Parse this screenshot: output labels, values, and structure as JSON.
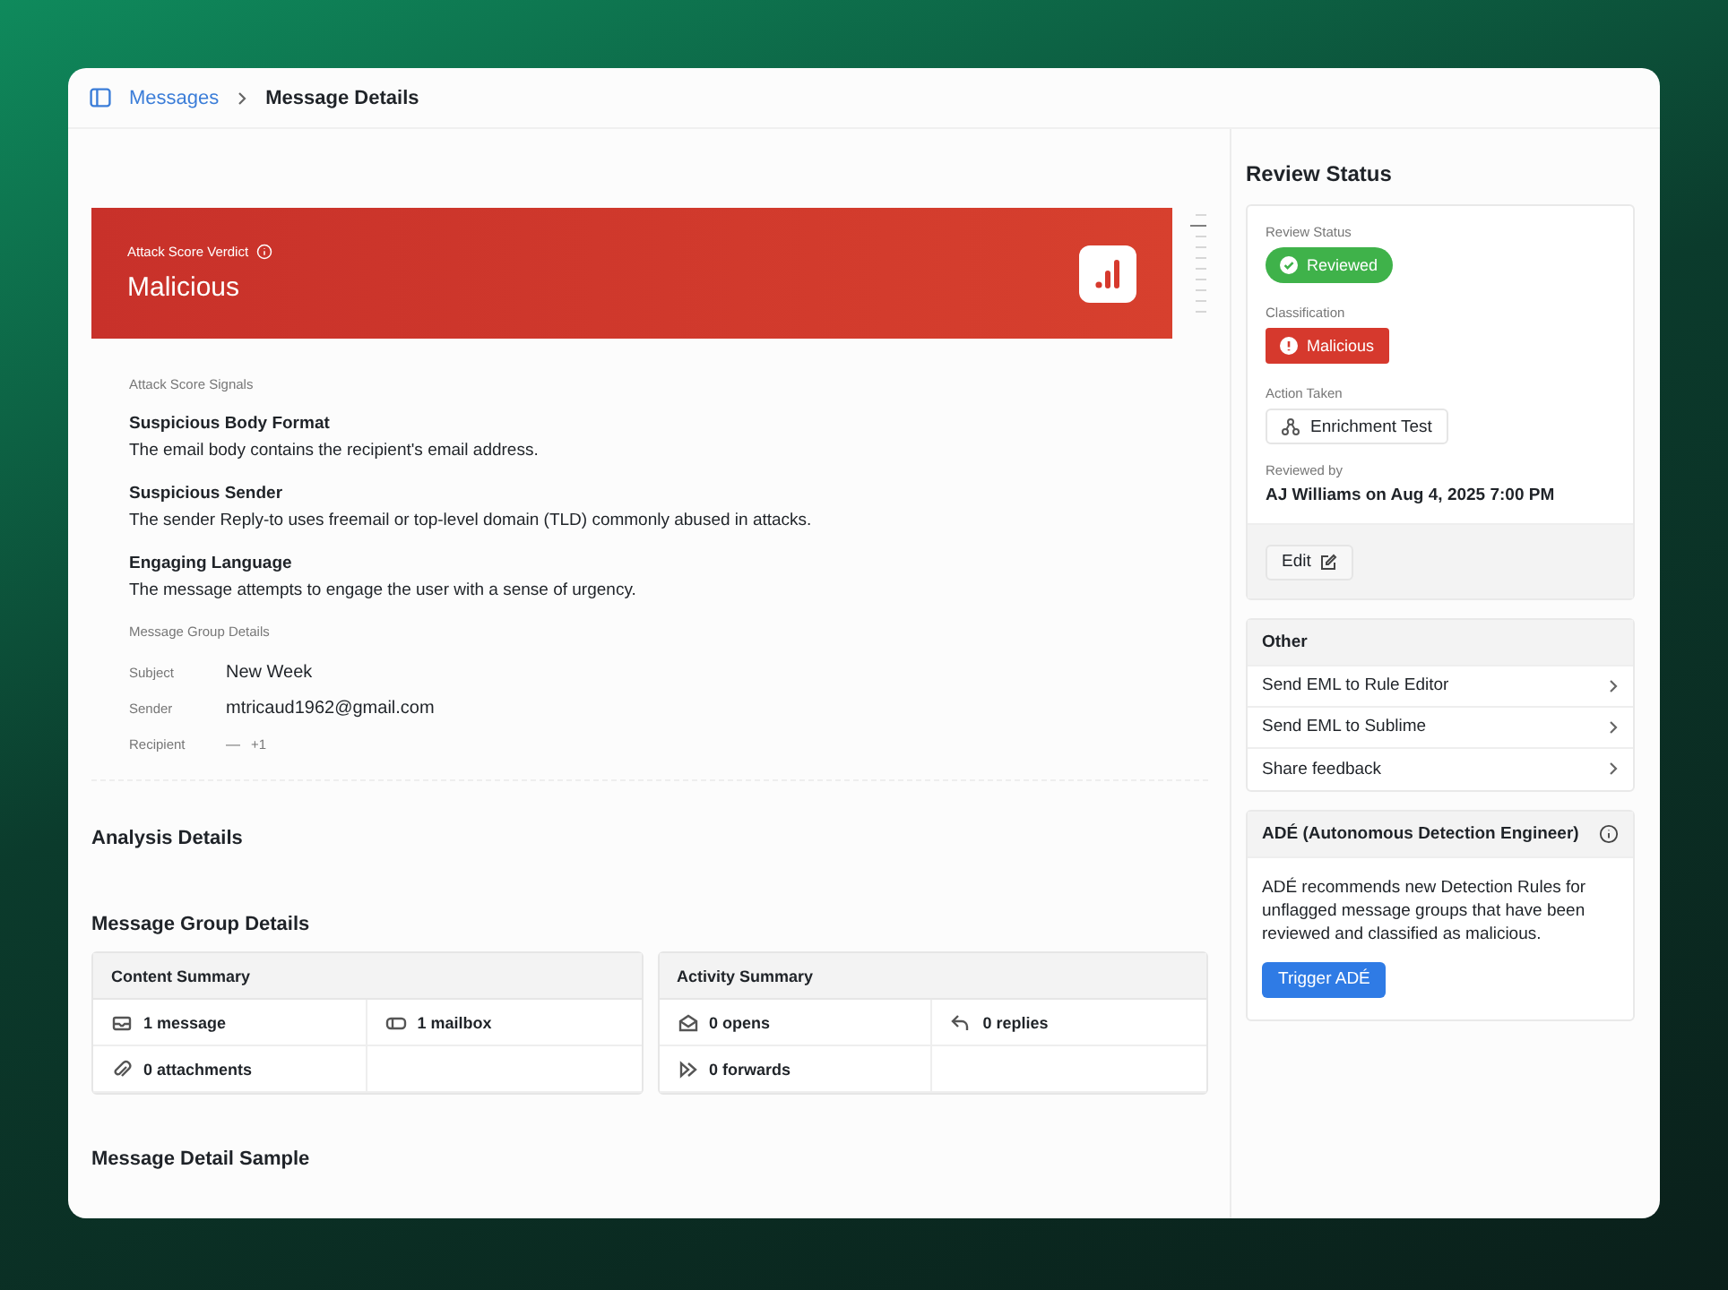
{
  "breadcrumb": [
    {
      "label": "Messages",
      "kind": "link"
    },
    {
      "label": "Message Details",
      "kind": "current"
    }
  ],
  "verdict": {
    "label": "Attack Score Verdict",
    "title": "Malicious"
  },
  "signals": {
    "heading": "Attack Score Signals",
    "items": [
      {
        "title": "Suspicious Body Format",
        "description": "The email body contains the recipient's email address."
      },
      {
        "title": "Suspicious Sender",
        "description": "The sender Reply-to uses freemail or top-level domain (TLD) commonly abused in attacks."
      },
      {
        "title": "Engaging Language",
        "description": "The message attempts to engage the user with a sense of urgency."
      }
    ]
  },
  "group_info": {
    "heading": "Message Group Details",
    "fields": [
      {
        "label": "Subject",
        "value": "New Week"
      },
      {
        "label": "Sender",
        "value": "mtricaud1962@gmail.com"
      },
      {
        "label": "Recipient",
        "value": "—",
        "extra": "+1"
      }
    ]
  },
  "analysis_heading": "Analysis Details",
  "group_heading": "Message Group Details",
  "summaries": [
    {
      "title": "Content Summary",
      "cells": [
        {
          "kind": "message",
          "text": "1 message"
        },
        {
          "kind": "mailbox",
          "text": "1 mailbox"
        },
        {
          "kind": "attachment",
          "text": "0 attachments"
        }
      ]
    },
    {
      "title": "Activity Summary",
      "cells": [
        {
          "kind": "open",
          "text": "0 opens"
        },
        {
          "kind": "reply",
          "text": "0 replies"
        },
        {
          "kind": "forward",
          "text": "0 forwards"
        }
      ]
    }
  ],
  "sample_heading": "Message Detail Sample",
  "review": {
    "title": "Review Status",
    "status": {
      "label": "Review Status",
      "badge": "Reviewed",
      "kind": "success"
    },
    "classification": {
      "label": "Classification",
      "badge": "Malicious",
      "kind": "danger"
    },
    "action": {
      "label": "Action Taken",
      "value": "Enrichment Test"
    },
    "reviewed_by": {
      "label": "Reviewed by",
      "value": "AJ Williams on Aug 4, 2025 7:00 PM"
    },
    "edit": "Edit"
  },
  "other": {
    "title": "Other",
    "items": [
      "Send EML to Rule Editor",
      "Send EML to Sublime",
      "Share feedback"
    ]
  },
  "ade": {
    "title": "ADÉ (Autonomous Detection Engineer)",
    "description": "ADÉ recommends new Detection Rules for unflagged message groups that have been reviewed and classified as malicious.",
    "button": "Trigger ADÉ"
  }
}
